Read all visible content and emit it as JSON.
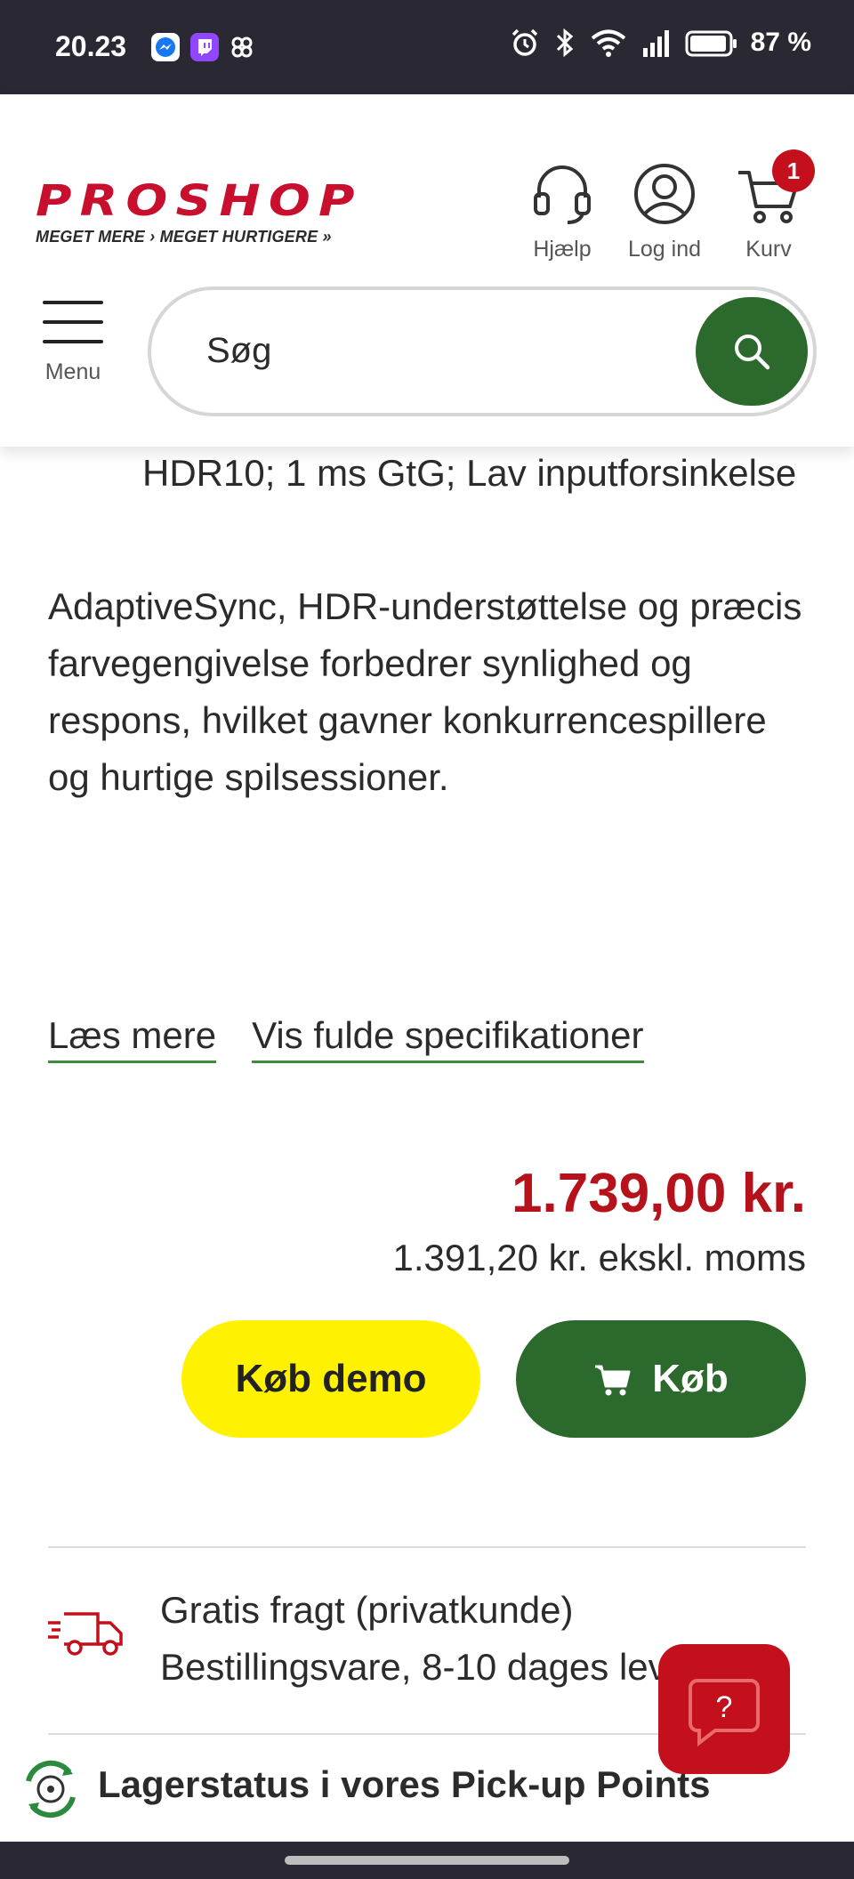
{
  "status_bar": {
    "time": "20.23",
    "battery_percent": "87 %",
    "icons": [
      "messenger-icon",
      "twitch-icon",
      "pinwheel-icon",
      "alarm-icon",
      "bluetooth-icon",
      "wifi-icon",
      "signal-icon",
      "battery-icon"
    ]
  },
  "header": {
    "logo_text": "PROSHOP",
    "logo_tagline": "MEGET MERE › MEGET HURTIGERE »",
    "help_label": "Hjælp",
    "login_label": "Log ind",
    "cart_label": "Kurv",
    "cart_count": "1",
    "menu_label": "Menu",
    "search_placeholder": "Søg"
  },
  "product": {
    "bullet_continuation": "HDR10; 1 ms GtG; Lav inputforsinkelse",
    "description": "AdaptiveSync, HDR-understøttelse og præcis farvegengivelse forbedrer synlighed og respons, hvilket gavner konkurrencespillere og hurtige spilsessioner.",
    "read_more_label": "Læs mere",
    "full_specs_label": "Vis fulde specifikationer",
    "price": "1.739,00 kr.",
    "price_ex_vat": "1.391,20 kr. ekskl. moms",
    "buy_demo_label": "Køb demo",
    "buy_label": "Køb"
  },
  "shipping": {
    "line1": "Gratis fragt (privatkunde)",
    "line2": "Bestillingsvare, 8-10 dages levering"
  },
  "pickup": {
    "label": "Lagerstatus i vores Pick-up Points"
  },
  "help_fab_label": "?",
  "colors": {
    "brand_red": "#c8102e",
    "price_red": "#b5121b",
    "brand_green": "#2b6a2c",
    "demo_yellow": "#fff200"
  }
}
